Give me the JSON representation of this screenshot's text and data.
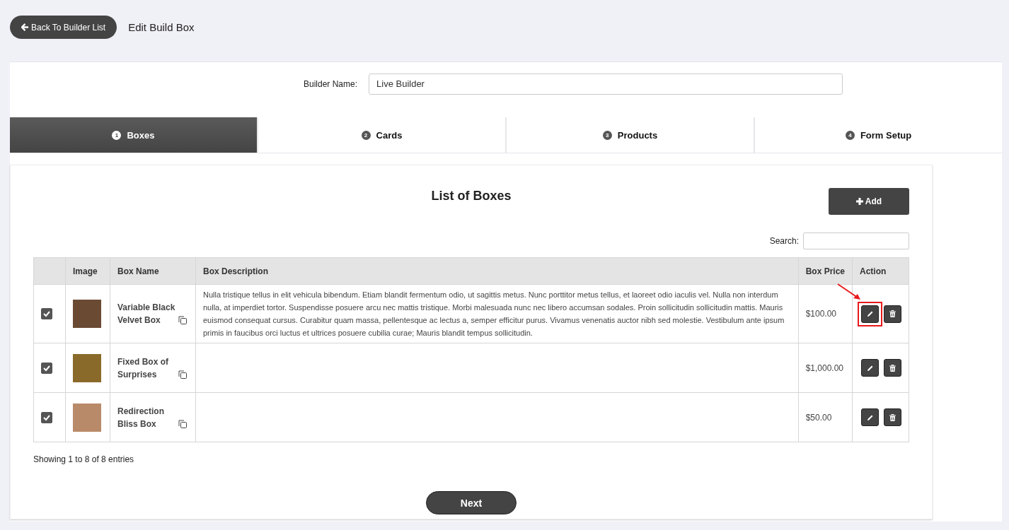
{
  "header": {
    "back_button": "Back To Builder List",
    "title": "Edit Build Box"
  },
  "builder_name": {
    "label": "Builder Name:",
    "value": "Live Builder"
  },
  "steps": [
    {
      "number": "1",
      "label": "Boxes",
      "selected": true
    },
    {
      "number": "2",
      "label": "Cards",
      "selected": false
    },
    {
      "number": "3",
      "label": "Products",
      "selected": false
    },
    {
      "number": "4",
      "label": "Form Setup",
      "selected": false
    }
  ],
  "list": {
    "title": "List of Boxes",
    "add_button": "Add",
    "search_label": "Search:",
    "columns": [
      "Image",
      "Box Name",
      "Box Description",
      "Box Price",
      "Action"
    ],
    "rows": [
      {
        "checked": true,
        "name": "Variable Black Velvet Box",
        "description": "Nulla tristique tellus in elit vehicula bibendum. Etiam blandit fermentum odio, ut sagittis metus. Nunc porttitor metus tellus, et laoreet odio iaculis vel. Nulla non interdum nulla, at imperdiet tortor. Suspendisse posuere arcu nec mattis tristique. Morbi malesuada nunc nec libero accumsan sodales. Proin sollicitudin sollicitudin mattis. Mauris euismod consequat cursus. Curabitur quam massa, pellentesque ac lectus a, semper efficitur purus. Vivamus venenatis auctor nibh sed molestie. Vestibulum ante ipsum primis in faucibus orci luctus et ultrices posuere cubilia curae; Mauris blandit tempus sollicitudin.",
        "price": "$100.00",
        "edit_highlighted": true
      },
      {
        "checked": true,
        "name": "Fixed Box of Surprises",
        "price": "$1,000.00",
        "edit_highlighted": false
      },
      {
        "checked": true,
        "name": "Redirection Bliss Box",
        "price": "$50.00",
        "edit_highlighted": false
      }
    ],
    "info": "Showing 1 to 8 of 8 entries"
  },
  "next_button": "Next"
}
